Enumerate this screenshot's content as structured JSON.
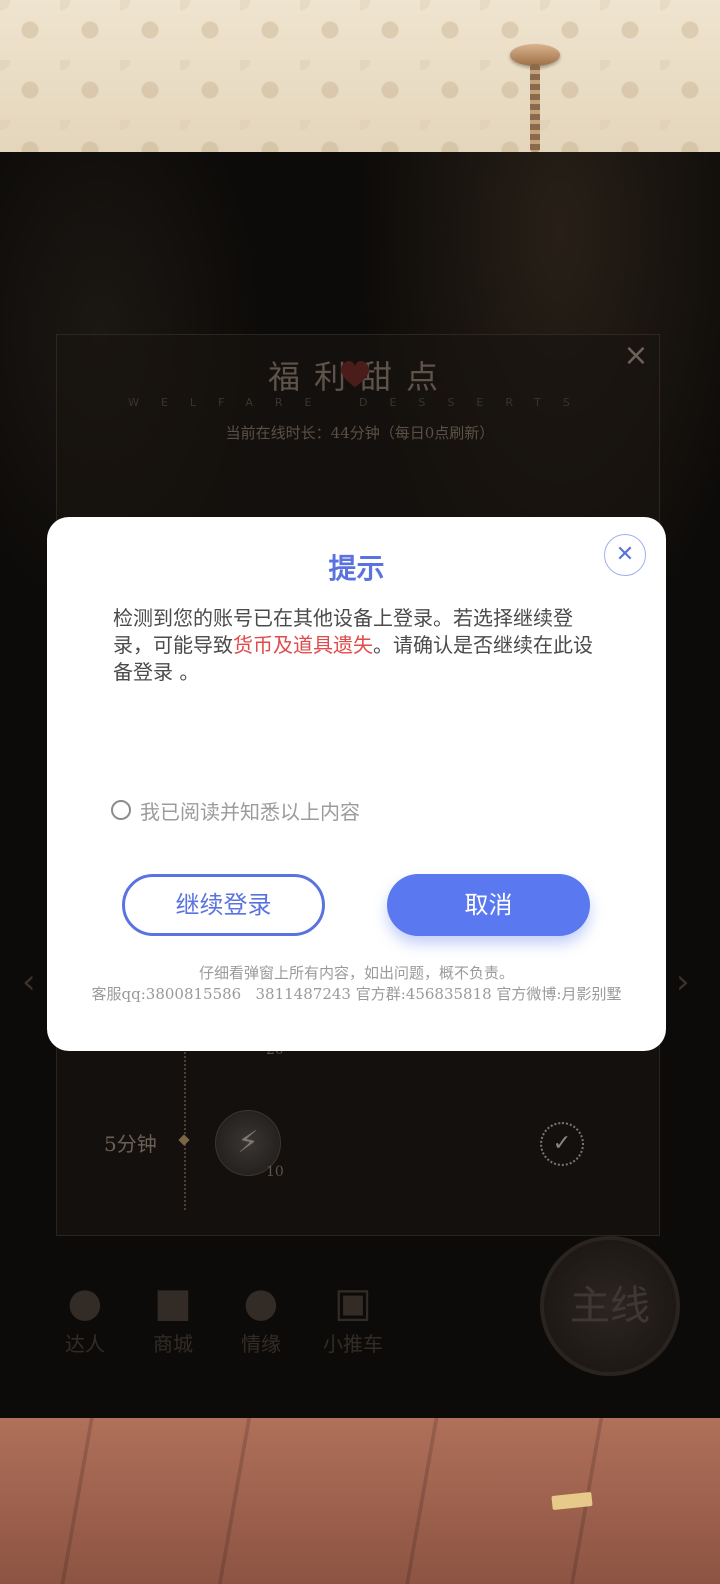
{
  "welfare_panel": {
    "title": "福利甜点",
    "subtitle": "WELFARE DESSERTS",
    "online_time": "当前在线时长：44分钟（每日0点刷新）",
    "item_label": "5分钟",
    "reward_top": "20",
    "reward_bottom": "10"
  },
  "bottom_nav": {
    "items": [
      {
        "label": "达人"
      },
      {
        "label": "商城"
      },
      {
        "label": "情缘"
      },
      {
        "label": "小推车"
      }
    ],
    "main_label": "主线"
  },
  "dialog": {
    "title": "提示",
    "message_part1": "检测到您的账号已在其他设备上登录。若选择继续登录，可能导致",
    "message_warning": "货币及道具遗失",
    "message_part2": "。请确认是否继续在此设备登录 。",
    "acknowledge_label": "我已阅读并知悉以上内容",
    "continue_label": "继续登录",
    "cancel_label": "取消",
    "disclaimer": "仔细看弹窗上所有内容，如出问题，概不负责。",
    "contact": "客服qq:3800815586   3811487243 官方群:456835818 官方微博:月影别墅",
    "close_icon": "close-icon",
    "accent_color": "#5a73e0",
    "warning_color": "#e14a4a"
  }
}
